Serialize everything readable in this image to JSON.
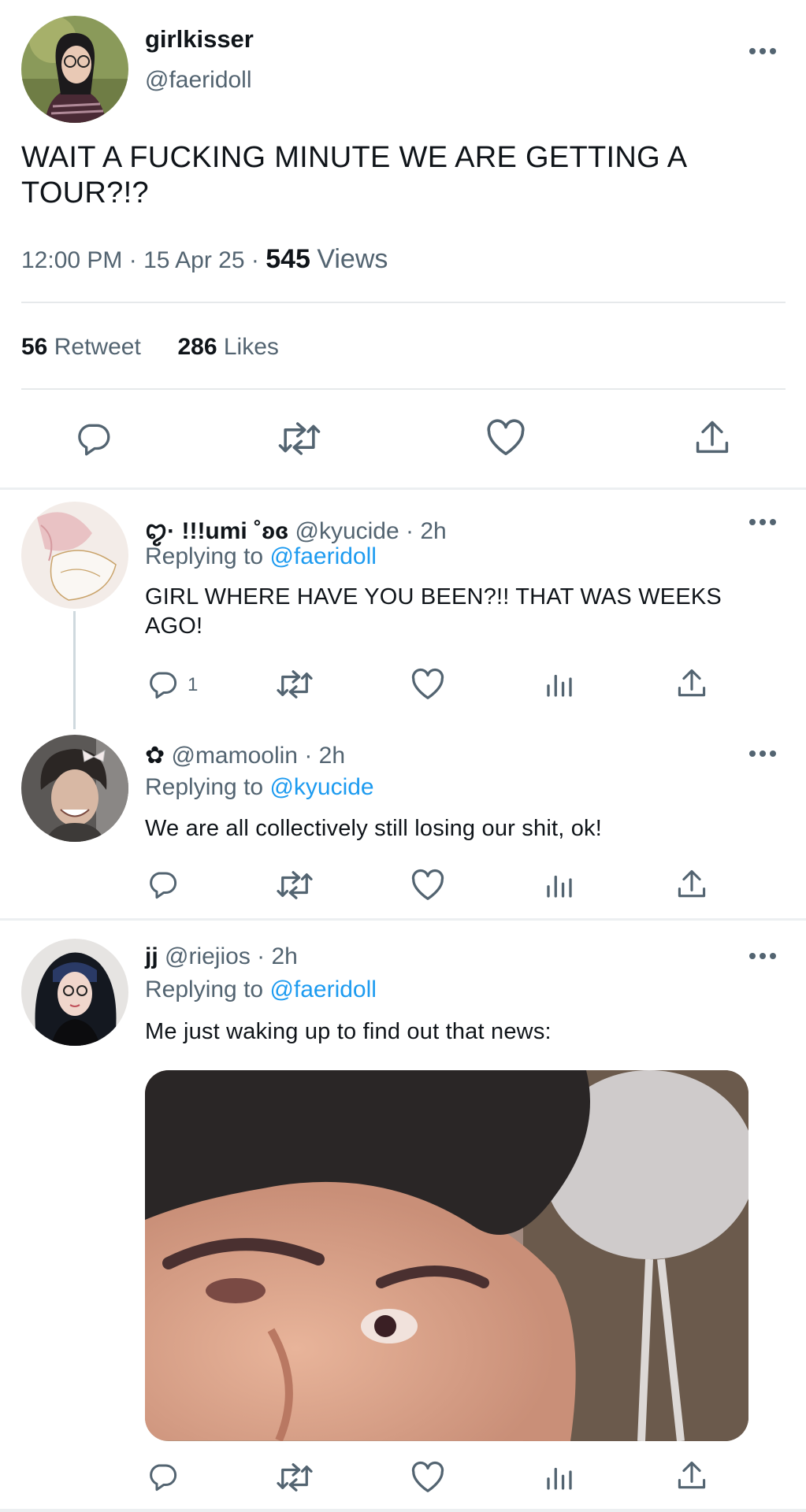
{
  "main_tweet": {
    "display_name": "girlkisser",
    "handle": "@faeridoll",
    "text": "WAIT A FUCKING MINUTE WE ARE GETTING A TOUR?!?",
    "time": "12:00 PM",
    "date": "15 Apr 25",
    "separator": "·",
    "views_count": "545",
    "views_label": "Views",
    "retweets_count": "56",
    "retweets_label": "Retweet",
    "likes_count": "286",
    "likes_label": "Likes"
  },
  "replies": [
    {
      "display_name": "ꨄ︎· !!!umi ˚ʚɞ",
      "handle": "@kyucide",
      "time": "· 2h",
      "replying_label": "Replying to",
      "replying_to": "@faeridoll",
      "text": "GIRL WHERE HAVE YOU BEEN?!! THAT WAS WEEKS AGO!",
      "reply_count": "1"
    },
    {
      "display_name": "✿",
      "handle": "@mamoolin",
      "time": "· 2h",
      "replying_label": "Replying to",
      "replying_to": "@kyucide",
      "text": "We are all collectively still losing our shit, ok!"
    },
    {
      "display_name": "jj",
      "handle": "@riejios",
      "time": "· 2h",
      "replying_label": "Replying to",
      "replying_to": "@faeridoll",
      "text": "Me just waking up to find out that news:"
    }
  ],
  "icons": {
    "reply": "reply-bubble-icon",
    "retweet": "retweet-icon",
    "like": "heart-icon",
    "views": "analytics-icon",
    "share": "share-icon",
    "more": "more-options-icon"
  },
  "colors": {
    "link": "#1d9bf0",
    "muted": "#536471",
    "text": "#0f1419",
    "divider": "#e6e9eb"
  }
}
